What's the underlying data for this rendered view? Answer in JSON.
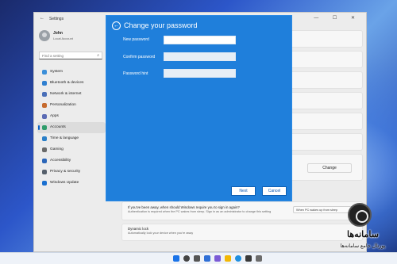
{
  "settings_window": {
    "title": "Settings",
    "back_glyph": "←",
    "window_controls": "— ☐ ✕"
  },
  "user": {
    "name": "John",
    "account": "Local Account"
  },
  "search": {
    "placeholder": "Find a setting",
    "icon": "search-icon"
  },
  "nav": {
    "items": [
      {
        "label": "System",
        "color": "#3b8fd9"
      },
      {
        "label": "Bluetooth & devices",
        "color": "#2f7fd0"
      },
      {
        "label": "Network & internet",
        "color": "#4a6fb8"
      },
      {
        "label": "Personalization",
        "color": "#c66a2e"
      },
      {
        "label": "Apps",
        "color": "#5b6bb4"
      },
      {
        "label": "Accounts",
        "color": "#2e9c6a"
      },
      {
        "label": "Time & language",
        "color": "#2a7fc8"
      },
      {
        "label": "Gaming",
        "color": "#6a6a6a"
      },
      {
        "label": "Accessibility",
        "color": "#2b66b8"
      },
      {
        "label": "Privacy & security",
        "color": "#555f6b"
      },
      {
        "label": "Windows Update",
        "color": "#1a6fd0"
      }
    ],
    "active_index": 5
  },
  "content": {
    "change_button": "Change",
    "away_question": "If you've been away, when should Windows require you to sign in again?",
    "away_sub": "Authentication is required when the PC wakes from sleep. Sign in as an administrator to change this setting",
    "away_select": "When PC wakes up from sleep",
    "dynamic_title": "Dynamic lock",
    "dynamic_sub": "Automatically lock your device when you're away"
  },
  "dialog": {
    "title": "Change your password",
    "back_glyph": "←",
    "fields": [
      {
        "label": "New password",
        "value": ""
      },
      {
        "label": "Confirm password",
        "value": ""
      },
      {
        "label": "Password hint",
        "value": ""
      }
    ],
    "next_label": "Next",
    "cancel_label": "Cancel",
    "background_color": "#1f7fdb"
  },
  "watermark": {
    "main": "سامانه‌ها",
    "sub": "پورتال جامع سامانه‌ها"
  }
}
